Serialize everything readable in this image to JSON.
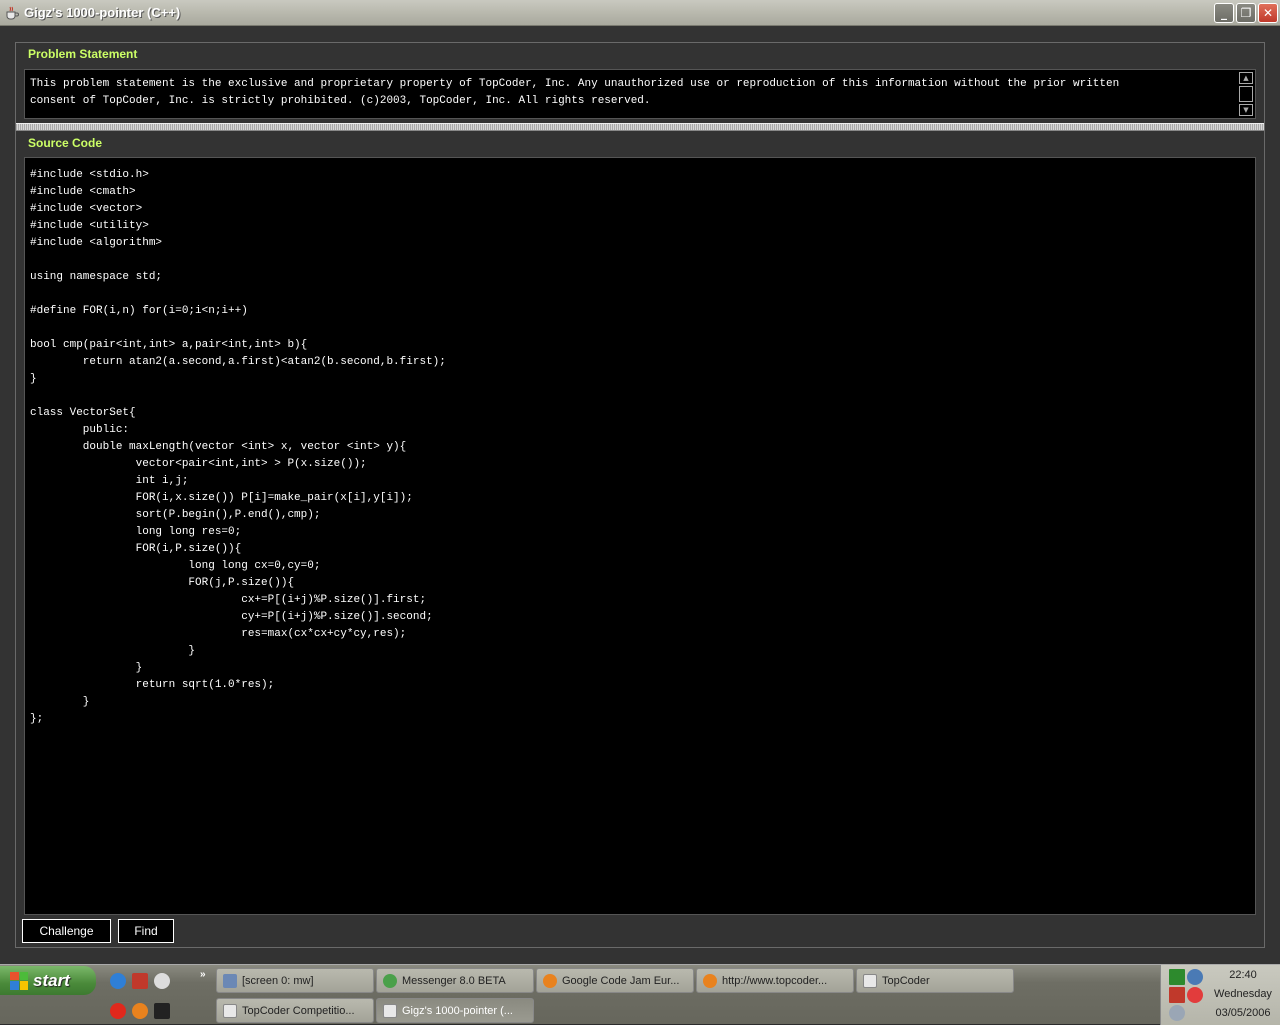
{
  "window": {
    "title": "Gigz's 1000-pointer (C++)",
    "controls": {
      "minimize": "_",
      "restore": "❐",
      "close": "✕"
    }
  },
  "problem": {
    "header": "Problem Statement",
    "text": "This problem statement is the exclusive and proprietary property of TopCoder, Inc. Any unauthorized use or reproduction of this information without the prior written\nconsent of TopCoder, Inc. is strictly prohibited. (c)2003, TopCoder, Inc. All rights reserved."
  },
  "source": {
    "header": "Source Code",
    "code": "#include <stdio.h>\n#include <cmath>\n#include <vector>\n#include <utility>\n#include <algorithm>\n\nusing namespace std;\n\n#define FOR(i,n) for(i=0;i<n;i++)\n\nbool cmp(pair<int,int> a,pair<int,int> b){\n        return atan2(a.second,a.first)<atan2(b.second,b.first);\n}\n\nclass VectorSet{\n        public:\n        double maxLength(vector <int> x, vector <int> y){\n                vector<pair<int,int> > P(x.size());\n                int i,j;\n                FOR(i,x.size()) P[i]=make_pair(x[i],y[i]);\n                sort(P.begin(),P.end(),cmp);\n                long long res=0;\n                FOR(i,P.size()){\n                        long long cx=0,cy=0;\n                        FOR(j,P.size()){\n                                cx+=P[(i+j)%P.size()].first;\n                                cy+=P[(i+j)%P.size()].second;\n                                res=max(cx*cx+cy*cy,res);\n                        }\n                }\n                return sqrt(1.0*res);\n        }\n};"
  },
  "buttons": {
    "challenge": "Challenge",
    "find": "Find"
  },
  "taskbar": {
    "start": "start",
    "more": "»",
    "tasks_row1": [
      "[screen 0: mw]",
      "Messenger 8.0 BETA",
      "Google Code Jam Eur...",
      "http://www.topcoder...",
      "TopCoder"
    ],
    "tasks_row2": [
      "TopCoder Competitio...",
      "Gigz's 1000-pointer (..."
    ],
    "clock": {
      "time": "22:40",
      "day": "Wednesday",
      "date": "03/05/2006"
    }
  },
  "colors": {
    "header_accent": "#ccff66",
    "panel_bg": "#333333",
    "text_bg": "#000000"
  }
}
